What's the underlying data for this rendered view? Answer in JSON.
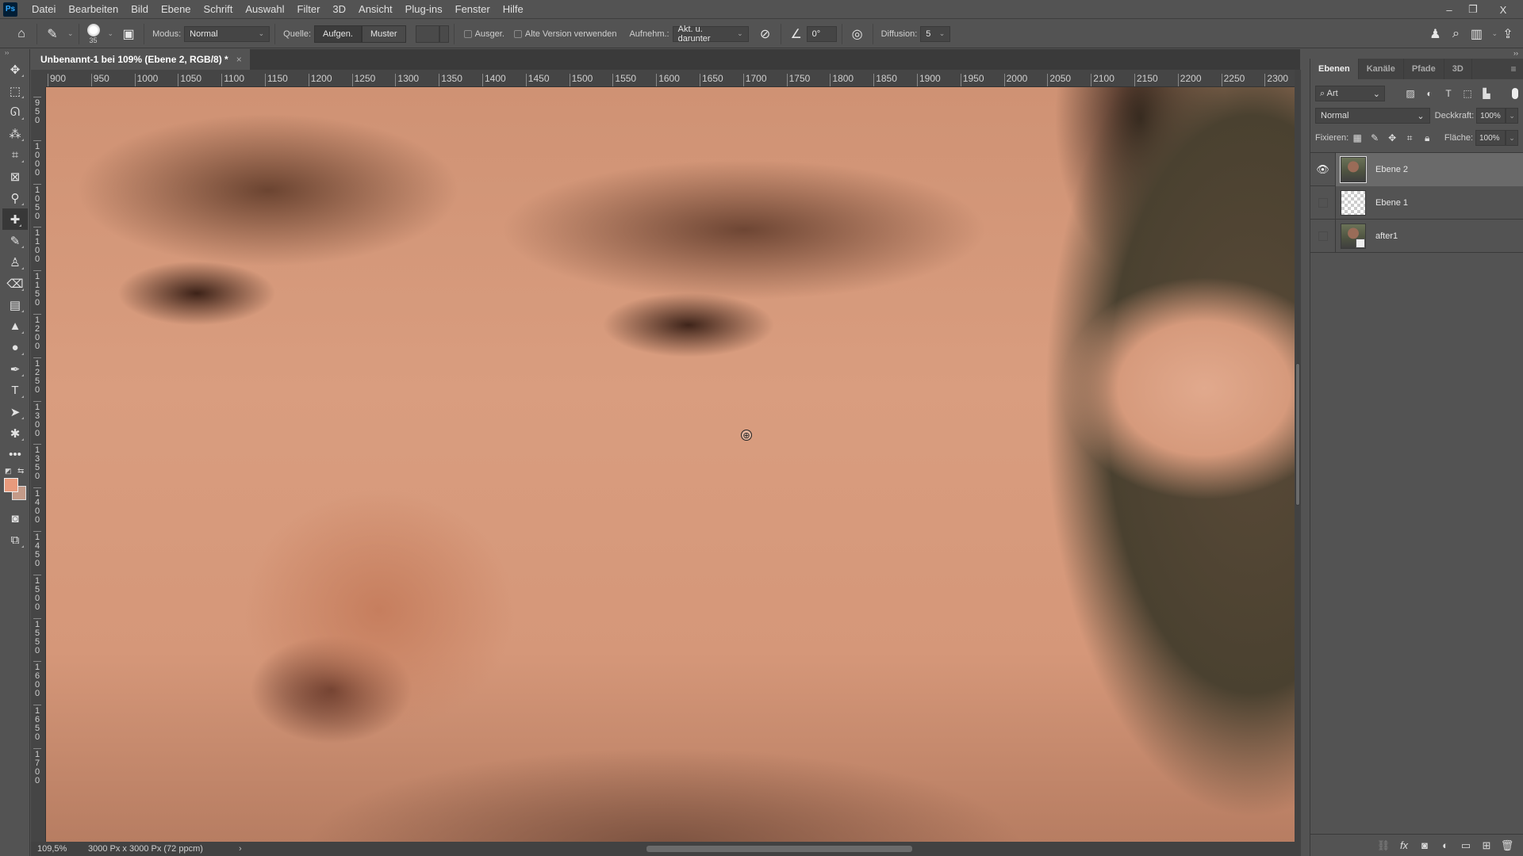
{
  "app": {
    "logo": "Ps"
  },
  "menu": [
    "Datei",
    "Bearbeiten",
    "Bild",
    "Ebene",
    "Schrift",
    "Auswahl",
    "Filter",
    "3D",
    "Ansicht",
    "Plug-ins",
    "Fenster",
    "Hilfe"
  ],
  "window_controls": {
    "minimize": "–",
    "restore": "❐",
    "close": "X"
  },
  "options": {
    "brush_size": "35",
    "mode_label": "Modus:",
    "mode_value": "Normal",
    "source_label": "Quelle:",
    "source_sampled": "Aufgen.",
    "source_pattern": "Muster",
    "aligned_label": "Ausger.",
    "legacy_label": "Alte Version verwenden",
    "sample_label": "Aufnehm.:",
    "sample_value": "Akt. u. darunter",
    "angle_value": "0°",
    "diffusion_label": "Diffusion:",
    "diffusion_value": "5"
  },
  "document": {
    "tab_title": "Unbenannt-1 bei 109% (Ebene 2, RGB/8) *",
    "close": "×"
  },
  "ruler_h": [
    "900",
    "950",
    "1000",
    "1050",
    "1100",
    "1150",
    "1200",
    "1250",
    "1300",
    "1350",
    "1400",
    "1450",
    "1500",
    "1550",
    "1600",
    "1650",
    "1700",
    "1750",
    "1800",
    "1850",
    "1900",
    "1950",
    "2000",
    "2050",
    "2100",
    "2150",
    "2200",
    "2250",
    "2300"
  ],
  "ruler_v": [
    "950",
    "1000",
    "1050",
    "1100",
    "1150",
    "1200",
    "1250",
    "1300",
    "1350",
    "1400",
    "1450",
    "1500",
    "1550",
    "1600",
    "1650",
    "1700"
  ],
  "status": {
    "zoom": "109,5%",
    "doc_info": "3000 Px x 3000 Px (72 ppcm)",
    "arrow": "›"
  },
  "colors": {
    "foreground": "#e89a7c",
    "background": "#c49a88"
  },
  "layers_panel": {
    "tabs": [
      "Ebenen",
      "Kanäle",
      "Pfade",
      "3D"
    ],
    "filter_value": "Art",
    "blend_mode": "Normal",
    "opacity_label": "Deckkraft:",
    "opacity_value": "100%",
    "lock_label": "Fixieren:",
    "fill_label": "Fläche:",
    "fill_value": "100%",
    "layers": [
      {
        "name": "Ebene 2",
        "visible": true,
        "active": true
      },
      {
        "name": "Ebene 1",
        "visible": false,
        "active": false
      },
      {
        "name": "after1",
        "visible": false,
        "active": false
      }
    ]
  }
}
